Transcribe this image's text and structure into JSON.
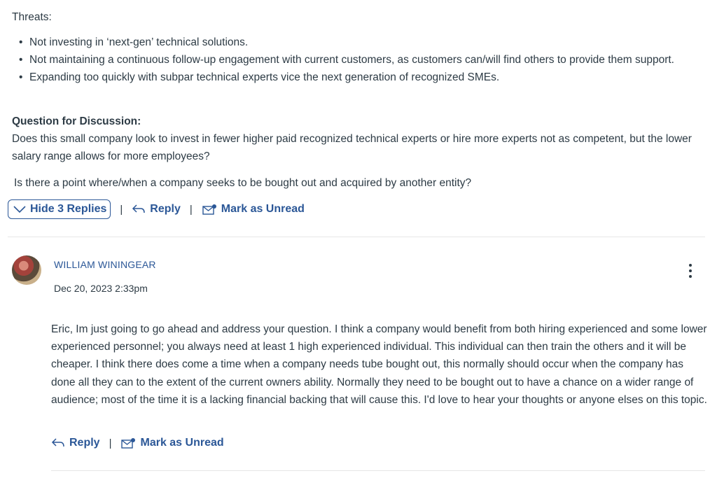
{
  "post": {
    "threats_label": "Threats:",
    "threat_items": [
      "Not investing in ‘next-gen’ technical solutions.",
      "Not maintaining a continuous follow-up engagement with current customers, as customers can/will find others to provide them support.",
      "Expanding too quickly with subpar technical experts vice the next generation of recognized SMEs."
    ],
    "question_heading": "Question for Discussion:",
    "question_text": "Does this small company look to invest in fewer higher paid recognized technical experts or hire more experts not as competent, but the lower salary range allows for more employees?",
    "question_text_2": "Is there a point where/when a company seeks to be bought out and acquired by another entity?",
    "actions": {
      "hide_replies": "Hide 3 Replies",
      "reply": "Reply",
      "mark_unread": "Mark as Unread",
      "separator": "|"
    }
  },
  "reply": {
    "author": "WILLIAM WININGEAR",
    "date": "Dec 20, 2023 2:33pm",
    "body": "Eric, Im just going to go ahead and address your question. I think a company would benefit from both hiring experienced and some lower experienced personnel; you always need at least 1 high experienced individual. This individual can then train the others and it will be cheaper. I think there does come a time when a company needs tube bought out, this normally should occur when the company has done all they can to the extent of the current owners ability. Normally they need to be bought out to have a chance on a wider range of audience; most of the time it is a lacking financial backing that will cause this. I'd love to hear your thoughts or anyone elses on this topic.",
    "actions": {
      "reply": "Reply",
      "mark_unread": "Mark as Unread",
      "separator": "|"
    }
  },
  "colors": {
    "link": "#2b5797",
    "text": "#2d3b45",
    "divider": "#e6e6e6"
  }
}
